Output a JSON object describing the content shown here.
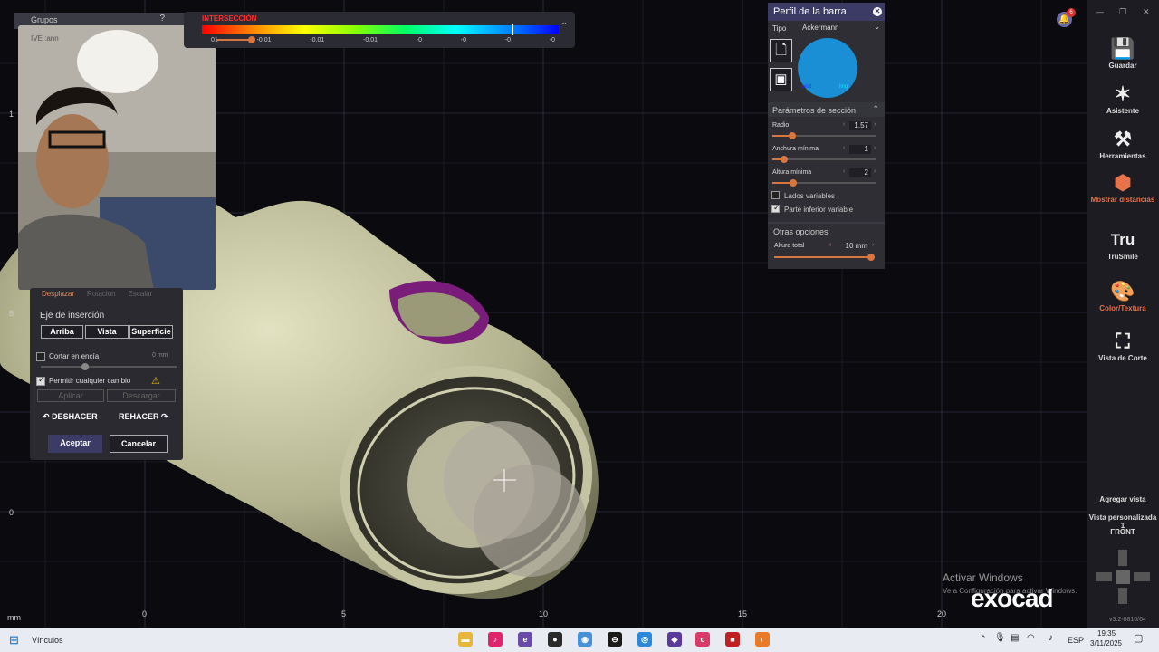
{
  "intersection": {
    "label": "INTERSECCIÓN",
    "ticks": [
      "01",
      "-0.01",
      "-0.01",
      "-0.01",
      "-0",
      "-0",
      "-0",
      "-0"
    ]
  },
  "groups_panel": {
    "title": "Grupos",
    "webcam_overlay_text": "IVE :ann"
  },
  "left_panel": {
    "tabs": [
      "Desplazar",
      "Rotación",
      "Escalar"
    ],
    "insertion_axis_label": "Eje de inserción",
    "btn_arriba": "Arriba",
    "btn_vista": "Vista",
    "btn_superficie": "Superficie",
    "cut_gum_label": "Cortar en encía",
    "cut_gum_value": "0 mm",
    "allow_change_label": "Permitir cualquier cambio",
    "apply_label": "Aplicar",
    "discard_label": "Descargar",
    "undo_label": "DESHACER",
    "redo_label": "REHACER",
    "accept_label": "Aceptar",
    "cancel_label": "Cancelar"
  },
  "profile_panel": {
    "title": "Perfil de la barra",
    "type_label": "Tipo",
    "type_value": "Ackermann",
    "preview_left_label": "vest",
    "preview_right_label": "ling",
    "section_params_label": "Parámetros de sección",
    "radio_label": "Radio",
    "radio_value": "1.57",
    "min_width_label": "Anchura mínima",
    "min_width_value": "1",
    "min_height_label": "Altura mínima",
    "min_height_value": "2",
    "variable_sides_label": "Lados variables",
    "variable_bottom_label": "Parte inferior variable",
    "other_options_label": "Otras opciones",
    "total_height_label": "Altura total",
    "total_height_value": "10 mm",
    "preview_color": "#1a8fd6"
  },
  "sidebar": {
    "items": [
      {
        "label": "Guardar",
        "icon": "save-icon"
      },
      {
        "label": "Asistente",
        "icon": "wand-icon"
      },
      {
        "label": "Herramientas",
        "icon": "tools-icon"
      },
      {
        "label": "Mostrar distancias",
        "icon": "distances-icon"
      },
      {
        "label": "TruSmile",
        "icon": "trusmile-icon"
      },
      {
        "label": "Color/Textura",
        "icon": "palette-icon"
      },
      {
        "label": "Vista de Corte",
        "icon": "cut-view-icon"
      }
    ],
    "notification_count": "6",
    "add_view": "Agregar vista",
    "custom_view": "Vista personalizada 1",
    "front": "FRONT",
    "version": "v3.2-8810/64"
  },
  "viewport": {
    "axis_unit": "mm",
    "x_ticks": [
      "0",
      "5",
      "10",
      "15",
      "20"
    ],
    "y_ticks": [
      "1",
      "8",
      "0"
    ],
    "watermark_title": "Activar Windows",
    "watermark_sub": "Ve a Configuración para activar Windows.",
    "brand": "exocad"
  },
  "taskbar": {
    "search_label": "Vínculos",
    "lang": "ESP",
    "time": "19:35",
    "date": "3/11/2025"
  },
  "colors": {
    "accent": "#e8734a",
    "panel_head": "#3b3b66",
    "model": "#b8b896"
  }
}
